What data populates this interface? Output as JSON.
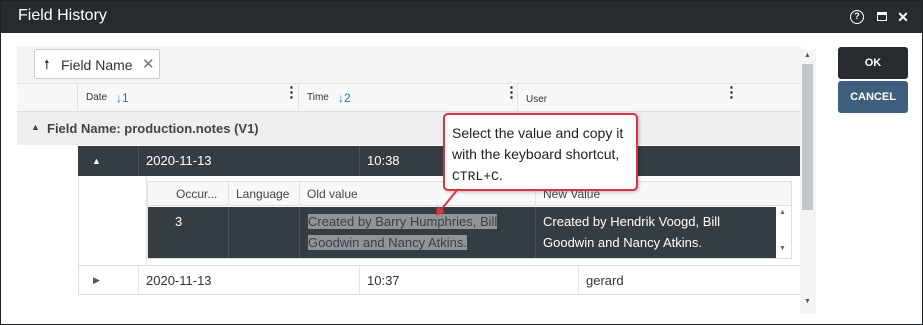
{
  "window": {
    "title": "Field History"
  },
  "titlebar_icons": {
    "help": "?",
    "close": "✕"
  },
  "groupbar": {
    "chip_arrow": "🠕",
    "chip_label": "Field Name",
    "chip_remove": "✕"
  },
  "columns": [
    {
      "label": "Date",
      "sort": "↓1"
    },
    {
      "label": "Time",
      "sort": "↓2"
    },
    {
      "label": "User",
      "sort": ""
    }
  ],
  "menu_glyph": "⋮",
  "group": {
    "expand_glyph": "▲",
    "label": "Field Name: production.notes (V1)"
  },
  "rows": [
    {
      "expand_glyph": "▲",
      "date": "2020-11-13",
      "time": "10:38",
      "user": ""
    },
    {
      "expand_glyph": "▶",
      "date": "2020-11-13",
      "time": "10:37",
      "user": "gerard"
    }
  ],
  "detail": {
    "headers": {
      "occurrence": "Occur...",
      "language": "Language",
      "old_value": "Old value",
      "new_value": "New Value"
    },
    "row": {
      "occurrence": "3",
      "language": "",
      "old_value": "Created by Barry Humphries, Bill Goodwin and Nancy Atkins.",
      "new_value": "Created by Hendrik Voogd, Bill Goodwin and Nancy Atkins."
    }
  },
  "scroll_glyphs": {
    "up": "▲",
    "down": "▼"
  },
  "buttons": {
    "ok": "OK",
    "cancel": "CANCEL"
  },
  "callout": {
    "text": "Select the value and copy it with the keyboard shortcut, ",
    "shortcut": "CTRL+C",
    "end": "."
  },
  "colors": {
    "titlebar": "#272b2f",
    "selected_row": "#353d43",
    "cancel_button": "#3c5f7d",
    "callout_border": "#d9343f",
    "sort_arrow": "#1e73be"
  }
}
